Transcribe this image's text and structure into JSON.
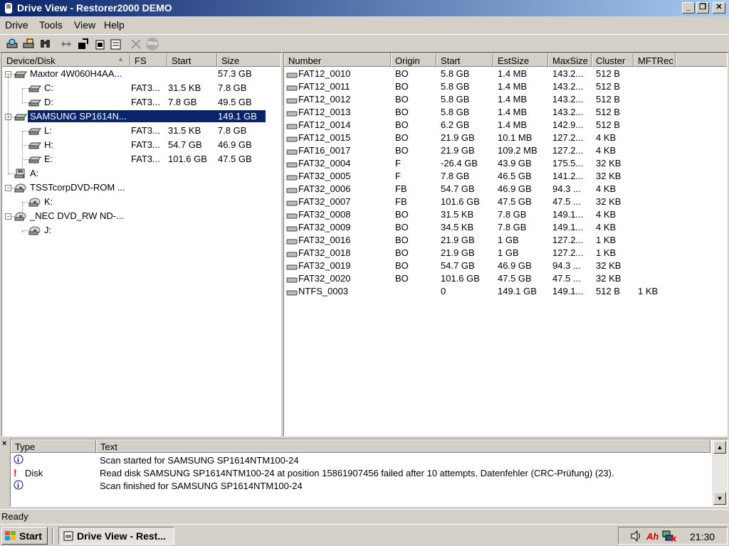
{
  "window": {
    "title": "Drive View - Restorer2000 DEMO"
  },
  "menu": [
    "Drive",
    "Tools",
    "View",
    "Help"
  ],
  "toolbar": {
    "icons": [
      "scan-drive-icon",
      "scan-settings-icon",
      "search-icon",
      "swap-icon",
      "open-file-icon",
      "export-icon",
      "properties-icon",
      "cancel-icon",
      "stop-icon"
    ],
    "stop_label": "Stop"
  },
  "left_pane": {
    "columns": [
      "Device/Disk",
      "FS",
      "Start",
      "Size"
    ],
    "rows": [
      {
        "name": "Maxtor 4W060H4AA...",
        "fs": "",
        "start": "",
        "size": "57.3 GB",
        "level": 0,
        "kind": "hdd",
        "expander": "-"
      },
      {
        "name": "C:",
        "fs": "FAT3...",
        "start": "31.5 KB",
        "size": "7.8 GB",
        "level": 1,
        "kind": "partition",
        "expander": ""
      },
      {
        "name": "D:",
        "fs": "FAT3...",
        "start": "7.8 GB",
        "size": "49.5 GB",
        "level": 1,
        "kind": "partition",
        "expander": ""
      },
      {
        "name": "SAMSUNG SP1614N...",
        "fs": "",
        "start": "",
        "size": "149.1 GB",
        "level": 0,
        "kind": "hdd",
        "expander": "-",
        "selected": true
      },
      {
        "name": "L:",
        "fs": "FAT3...",
        "start": "31.5 KB",
        "size": "7.8 GB",
        "level": 1,
        "kind": "partition",
        "expander": ""
      },
      {
        "name": "H:",
        "fs": "FAT3...",
        "start": "54.7 GB",
        "size": "46.9 GB",
        "level": 1,
        "kind": "partition",
        "expander": ""
      },
      {
        "name": "E:",
        "fs": "FAT3...",
        "start": "101.6 GB",
        "size": "47.5 GB",
        "level": 1,
        "kind": "partition",
        "expander": ""
      },
      {
        "name": "A:",
        "fs": "",
        "start": "",
        "size": "",
        "level": 0,
        "kind": "floppy",
        "expander": ""
      },
      {
        "name": "TSSTcorpDVD-ROM ...",
        "fs": "",
        "start": "",
        "size": "",
        "level": 0,
        "kind": "cdrom",
        "expander": "-"
      },
      {
        "name": "K:",
        "fs": "",
        "start": "",
        "size": "",
        "level": 1,
        "kind": "cdrom",
        "expander": ""
      },
      {
        "name": "_NEC DVD_RW ND-...",
        "fs": "",
        "start": "",
        "size": "",
        "level": 0,
        "kind": "cdrom",
        "expander": "-"
      },
      {
        "name": "J:",
        "fs": "",
        "start": "",
        "size": "",
        "level": 1,
        "kind": "cdrom",
        "expander": ""
      }
    ]
  },
  "right_pane": {
    "columns": [
      "Number",
      "Origin",
      "Start",
      "EstSize",
      "MaxSize",
      "Cluster",
      "MFTRec"
    ],
    "rows": [
      [
        "FAT12_0010",
        "BO",
        "5.8 GB",
        "1.4 MB",
        "143.2...",
        "512 B",
        ""
      ],
      [
        "FAT12_0011",
        "BO",
        "5.8 GB",
        "1.4 MB",
        "143.2...",
        "512 B",
        ""
      ],
      [
        "FAT12_0012",
        "BO",
        "5.8 GB",
        "1.4 MB",
        "143.2...",
        "512 B",
        ""
      ],
      [
        "FAT12_0013",
        "BO",
        "5.8 GB",
        "1.4 MB",
        "143.2...",
        "512 B",
        ""
      ],
      [
        "FAT12_0014",
        "BO",
        "6.2 GB",
        "1.4 MB",
        "142.9...",
        "512 B",
        ""
      ],
      [
        "FAT12_0015",
        "BO",
        "21.9 GB",
        "10.1 MB",
        "127.2...",
        "4 KB",
        ""
      ],
      [
        "FAT16_0017",
        "BO",
        "21.9 GB",
        "109.2 MB",
        "127.2...",
        "4 KB",
        ""
      ],
      [
        "FAT32_0004",
        "F",
        "-26.4 GB",
        "43.9 GB",
        "175.5...",
        "32 KB",
        ""
      ],
      [
        "FAT32_0005",
        "F",
        "7.8 GB",
        "46.5 GB",
        "141.2...",
        "32 KB",
        ""
      ],
      [
        "FAT32_0006",
        "FB",
        "54.7 GB",
        "46.9 GB",
        "94.3 ...",
        "4 KB",
        ""
      ],
      [
        "FAT32_0007",
        "FB",
        "101.6 GB",
        "47.5 GB",
        "47.5 ...",
        "32 KB",
        ""
      ],
      [
        "FAT32_0008",
        "BO",
        "31.5 KB",
        "7.8 GB",
        "149.1...",
        "4 KB",
        ""
      ],
      [
        "FAT32_0009",
        "BO",
        "34.5 KB",
        "7.8 GB",
        "149.1...",
        "4 KB",
        ""
      ],
      [
        "FAT32_0016",
        "BO",
        "21.9 GB",
        "1 GB",
        "127.2...",
        "1 KB",
        ""
      ],
      [
        "FAT32_0018",
        "BO",
        "21.9 GB",
        "1 GB",
        "127.2...",
        "1 KB",
        ""
      ],
      [
        "FAT32_0019",
        "BO",
        "54.7 GB",
        "46.9 GB",
        "94.3 ...",
        "32 KB",
        ""
      ],
      [
        "FAT32_0020",
        "BO",
        "101.6 GB",
        "47.5 GB",
        "47.5 ...",
        "32 KB",
        ""
      ],
      [
        "NTFS_0003",
        "",
        "0",
        "149.1 GB",
        "149.1...",
        "512 B",
        "1 KB"
      ]
    ]
  },
  "log": {
    "columns": [
      "Type",
      "Text"
    ],
    "rows": [
      {
        "icon": "info-icon",
        "type": "",
        "text": "Scan started for SAMSUNG SP1614NTM100-24"
      },
      {
        "icon": "error-icon",
        "type": "Disk",
        "text": "Read disk SAMSUNG SP1614NTM100-24 at position 15861907456 failed after 10 attempts. Datenfehler (CRC-Prüfung) (23)."
      },
      {
        "icon": "info-icon",
        "type": "",
        "text": "Scan finished for SAMSUNG SP1614NTM100-24"
      }
    ]
  },
  "status": {
    "text": "Ready"
  },
  "taskbar": {
    "start_label": "Start",
    "task_label": "Drive View - Rest...",
    "clock": "21:30"
  },
  "colors": {
    "title_start": "#0a246a",
    "title_end": "#a6caf0",
    "selection": "#0a246a",
    "face": "#d4d0c8",
    "error": "#ff0000",
    "info": "#0000cc"
  }
}
